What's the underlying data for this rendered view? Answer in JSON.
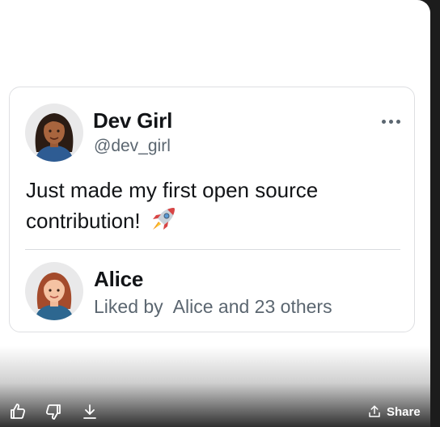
{
  "post": {
    "author_name": "Dev Girl",
    "author_handle": "@dev_girl",
    "text": "Just made my first open source contribution!",
    "emoji": "rocket",
    "more_icon": "more-horizontal-icon"
  },
  "liker": {
    "name": "Alice",
    "liked_by_label": "Liked by",
    "liked_by_text": "Alice and 23 others"
  },
  "toolbar": {
    "like_icon": "thumbs-up-icon",
    "dislike_icon": "thumbs-down-icon",
    "download_icon": "download-icon",
    "share_label": "Share",
    "share_icon": "share-icon"
  },
  "colors": {
    "text_primary": "#121417",
    "text_secondary": "#5b6670",
    "card_border": "#dedfe2"
  }
}
